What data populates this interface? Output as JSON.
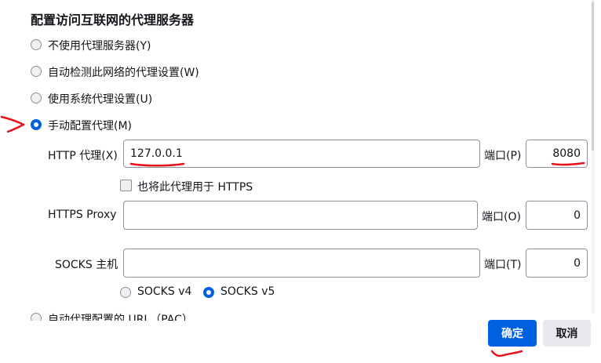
{
  "dialog": {
    "title": "配置访问互联网的代理服务器"
  },
  "proxy_options": [
    {
      "label": "不使用代理服务器(Y)",
      "selected": false
    },
    {
      "label": "自动检测此网络的代理设置(W)",
      "selected": false
    },
    {
      "label": "使用系统代理设置(U)",
      "selected": false
    },
    {
      "label": "手动配置代理(M)",
      "selected": true
    }
  ],
  "manual": {
    "http_label": "HTTP 代理(X)",
    "http_value": "127.0.0.1",
    "http_port_label": "端口(P)",
    "http_port_value": "8080",
    "also_https_label": "也将此代理用于 HTTPS",
    "also_https_checked": false,
    "https_label": "HTTPS Proxy",
    "https_value": "",
    "https_port_label": "端口(O)",
    "https_port_value": "0",
    "socks_label": "SOCKS 主机",
    "socks_value": "",
    "socks_port_label": "端口(T)",
    "socks_port_value": "0",
    "socks_v4_label": "SOCKS v4",
    "socks_v5_label": "SOCKS v5",
    "socks_version_selected": "SOCKS v5"
  },
  "auto_config": {
    "label": "自动代理配置的 URL（PAC）"
  },
  "buttons": {
    "ok_label": "确定",
    "cancel_label": "取消"
  },
  "colors": {
    "accent": "#0061e0",
    "annotation": "#e8101a"
  }
}
